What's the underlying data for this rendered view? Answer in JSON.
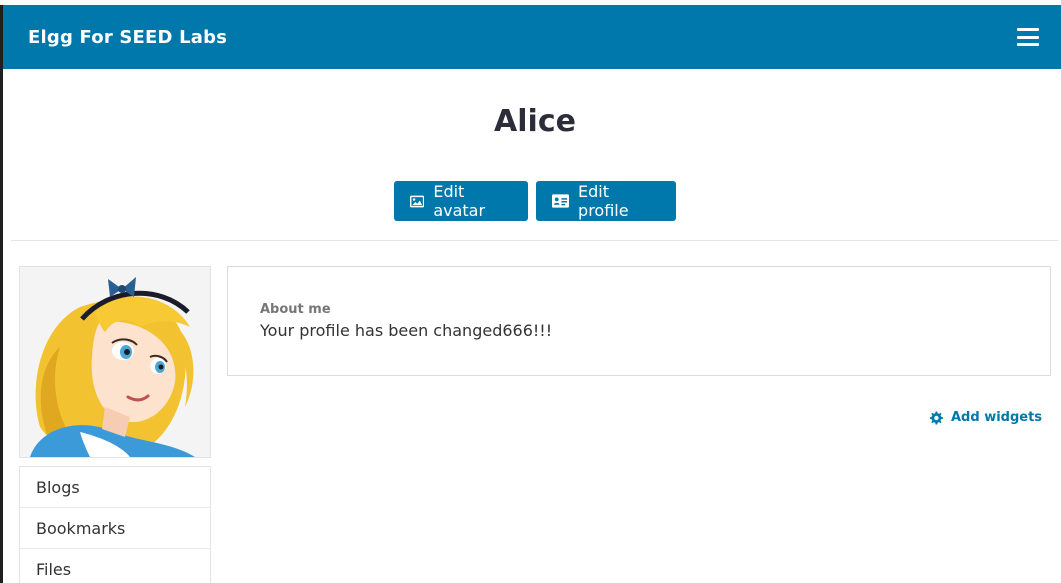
{
  "header": {
    "site_name": "Elgg For SEED Labs",
    "menu_icon": "hamburger-icon"
  },
  "profile": {
    "name": "Alice"
  },
  "actions": {
    "edit_avatar_label": "Edit avatar",
    "edit_avatar_icon": "image-icon",
    "edit_profile_label": "Edit profile",
    "edit_profile_icon": "id-card-icon"
  },
  "owner_menu": {
    "items": [
      {
        "label": "Blogs"
      },
      {
        "label": "Bookmarks"
      },
      {
        "label": "Files"
      }
    ]
  },
  "about": {
    "label": "About me",
    "text": "Your profile has been changed666!!!"
  },
  "widgets": {
    "add_label": "Add widgets",
    "add_icon": "gear-icon"
  },
  "colors": {
    "brand": "#0078ac",
    "title_text": "#2d2d3a"
  }
}
